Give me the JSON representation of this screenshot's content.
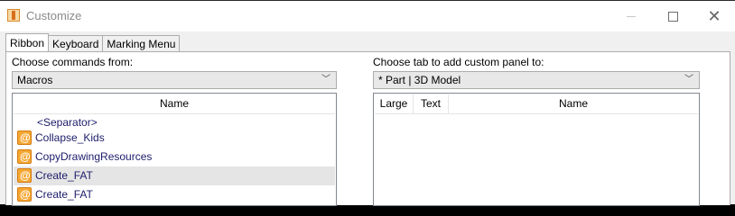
{
  "window": {
    "title": "Customize",
    "icon": "autodesk-inventor-icon",
    "controls": [
      "minimize",
      "maximize",
      "close"
    ]
  },
  "tabs": [
    {
      "label": "Ribbon",
      "active": true
    },
    {
      "label": "Keyboard",
      "active": false
    },
    {
      "label": "Marking Menu",
      "active": false
    }
  ],
  "left": {
    "label": "Choose commands from:",
    "combo_value": "Macros",
    "list_header": "Name",
    "items": [
      {
        "label": "<Separator>",
        "icon": null,
        "selected": false
      },
      {
        "label": "Collapse_Kids",
        "icon": "macro-icon",
        "selected": false
      },
      {
        "label": "CopyDrawingResources",
        "icon": "macro-icon",
        "selected": false
      },
      {
        "label": "Create_FAT",
        "icon": "macro-icon",
        "selected": true
      },
      {
        "label": "Create_FAT",
        "icon": "macro-icon",
        "selected": false
      }
    ]
  },
  "right": {
    "label": "Choose tab to add custom panel to:",
    "combo_value": "* Part | 3D Model",
    "columns": [
      "Large",
      "Text",
      "Name"
    ]
  }
}
